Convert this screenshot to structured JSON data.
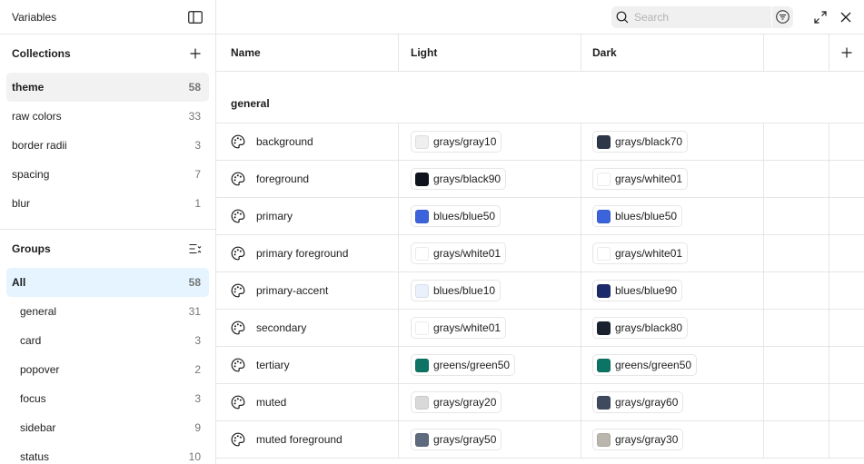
{
  "sidebar": {
    "title": "Variables",
    "collections": {
      "title": "Collections",
      "items": [
        {
          "label": "theme",
          "count": "58",
          "selected": true
        },
        {
          "label": "raw colors",
          "count": "33"
        },
        {
          "label": "border radii",
          "count": "3"
        },
        {
          "label": "spacing",
          "count": "7"
        },
        {
          "label": "blur",
          "count": "1"
        }
      ]
    },
    "groups": {
      "title": "Groups",
      "items": [
        {
          "label": "All",
          "count": "58",
          "selected": true
        },
        {
          "label": "general",
          "count": "31"
        },
        {
          "label": "card",
          "count": "3"
        },
        {
          "label": "popover",
          "count": "2"
        },
        {
          "label": "focus",
          "count": "3"
        },
        {
          "label": "sidebar",
          "count": "9"
        },
        {
          "label": "status",
          "count": "10"
        }
      ]
    }
  },
  "topbar": {
    "search_placeholder": "Search"
  },
  "table": {
    "headers": {
      "name": "Name",
      "light": "Light",
      "dark": "Dark"
    },
    "group_label": "general",
    "rows": [
      {
        "name": "background",
        "light": {
          "label": "grays/gray10",
          "color": "#efefef"
        },
        "dark": {
          "label": "grays/black70",
          "color": "#2d3748"
        }
      },
      {
        "name": "foreground",
        "light": {
          "label": "grays/black90",
          "color": "#0f141c"
        },
        "dark": {
          "label": "grays/white01",
          "color": "#ffffff"
        }
      },
      {
        "name": "primary",
        "light": {
          "label": "blues/blue50",
          "color": "#3b63dc"
        },
        "dark": {
          "label": "blues/blue50",
          "color": "#3b63dc"
        }
      },
      {
        "name": "primary foreground",
        "light": {
          "label": "grays/white01",
          "color": "#ffffff"
        },
        "dark": {
          "label": "grays/white01",
          "color": "#ffffff"
        }
      },
      {
        "name": "primary-accent",
        "light": {
          "label": "blues/blue10",
          "color": "#eaf1fd"
        },
        "dark": {
          "label": "blues/blue90",
          "color": "#1c2a6b"
        }
      },
      {
        "name": "secondary",
        "light": {
          "label": "grays/white01",
          "color": "#ffffff"
        },
        "dark": {
          "label": "grays/black80",
          "color": "#1a2230"
        }
      },
      {
        "name": "tertiary",
        "light": {
          "label": "greens/green50",
          "color": "#0c7464"
        },
        "dark": {
          "label": "greens/green50",
          "color": "#0c7464"
        }
      },
      {
        "name": "muted",
        "light": {
          "label": "grays/gray20",
          "color": "#d9d9d9"
        },
        "dark": {
          "label": "grays/gray60",
          "color": "#3f4a5e"
        }
      },
      {
        "name": "muted foreground",
        "light": {
          "label": "grays/gray50",
          "color": "#5e6a7e"
        },
        "dark": {
          "label": "grays/gray30",
          "color": "#bab5ad"
        }
      }
    ]
  }
}
